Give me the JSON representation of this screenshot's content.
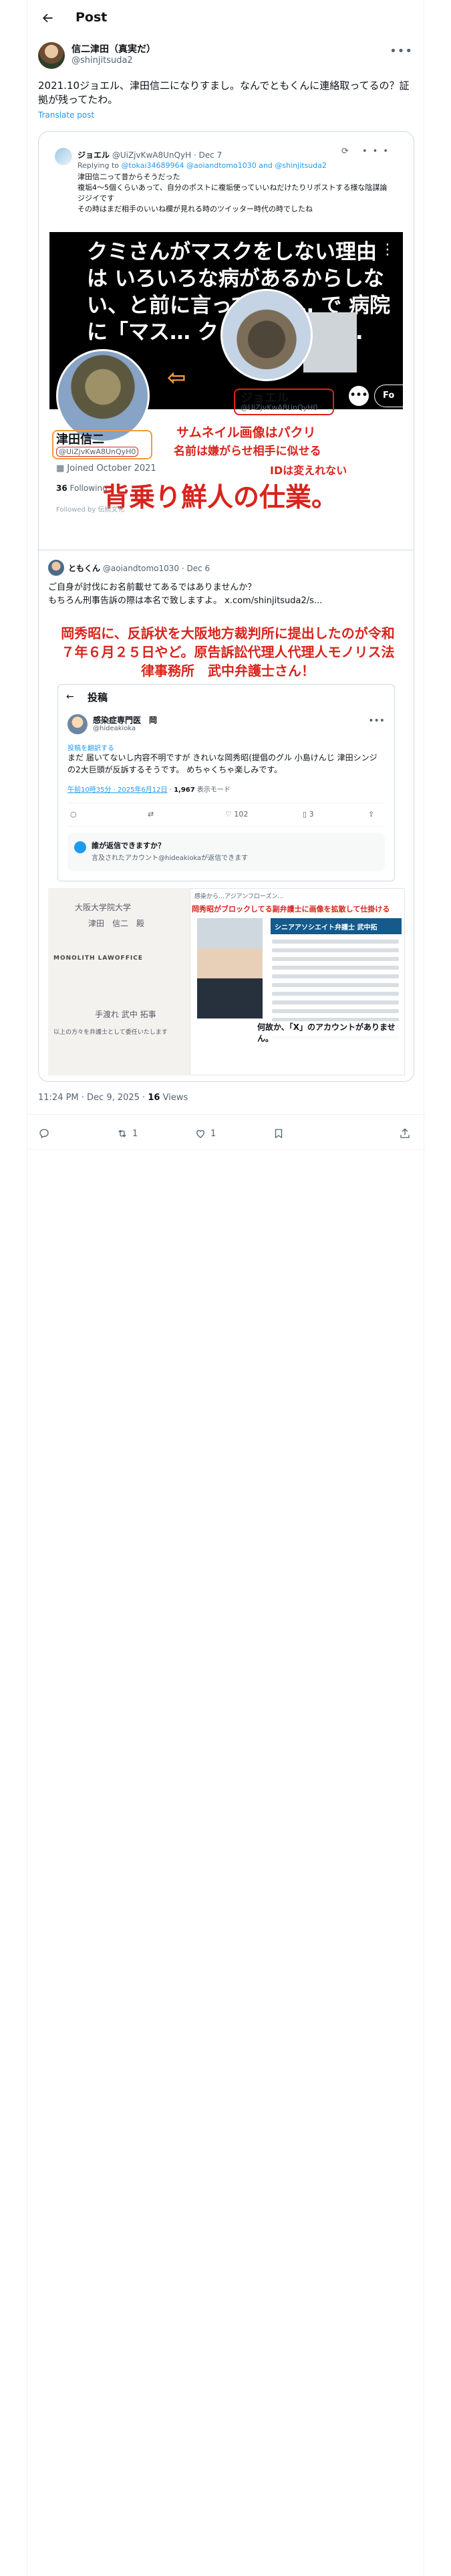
{
  "header": {
    "title": "Post"
  },
  "author": {
    "name": "信二津田（真実だ）",
    "handle": "@shinjitsuda2"
  },
  "post": {
    "text": "2021.10ジョエル、津田信二になりすまし。なんでともくんに連絡取ってるの？証拠が残ってたわ。",
    "translate_label": "Translate post"
  },
  "quote1": {
    "name": "ジョエル",
    "handle_time": "@UiZjvKwA8UnQyH · Dec 7",
    "replying_prefix": "Replying to",
    "replying_to": "@tokai34689964 @aoiandtomo1030 and @shinjitsuda2",
    "body": "津田信二って昔からそうだった\n複垢4〜5個くらいあって、自分のポストに複垢使っていいねだけたりリポストする様な陰謀論ジジイです\nその時はまだ相手のいいね欄が見れる時のツイッター時代の時でしたね",
    "image": {
      "dark_text": "クミさんがマスクをしない理由は いろいろな病があるからしない、と前に言ってた…… で 病院に「マス… クして……でた…",
      "more": "•••",
      "follow": "Fo",
      "joel_name": "ジョエル",
      "joel_handle": "@UiZjvKwA8UnQyH0",
      "tsuda_name": "津田信二",
      "tsuda_handle": "@UiZjvKwA8UnQyH0",
      "red_1": "サムネイル画像はパクリ",
      "red_2": "名前は嫌がらせ相手に似せる",
      "red_3": "IDは変えれない",
      "joined": "Joined October 2021",
      "following_count": "36",
      "following_label": "Following",
      "followed_by": "Followed by 伝統文化",
      "big_red": "背乗り鮮人の仕業。"
    }
  },
  "quote2": {
    "name": "ともくん",
    "handle_time": "@aoiandtomo1030 · Dec 6",
    "body": "ご自身が討伐にお名前載せてあるではありませんか？\nもちろん刑事告訴の際は本名で致しますよ。 x.com/shinjitsuda2/s...",
    "red_text": "岡秀昭に、反訴状を大阪地方裁判所に提出したのが令和７年６月２５日やど。原告訴訟代理人代理人モノリス法律事務所　武中弁護士さん！",
    "inner": {
      "back": "←",
      "title": "投稿",
      "name": "感染症専門医　岡",
      "handle": "@hideakioka",
      "translate": "投稿を翻訳する",
      "text": "まだ 届いてないし内容不明ですが きれいな岡秀昭(提倡のグル 小島けんじ 津田シンジの2大巨頭が反訴するそうです。 めちゃくちゃ楽しみです。",
      "time": "午前10時35分 · 2025年6月12日",
      "views": "1,967",
      "views_label": "表示モード",
      "replies": "",
      "reposts": "",
      "likes": "102",
      "bookmarks": "3",
      "notice_title": "誰が返信できますか？",
      "notice_sub": "言及されたアカウント@hideakiokaが返信できます"
    },
    "doc_left": {
      "line1": "大阪大学院大学",
      "line2": "津田　信二　殿",
      "logo": "MONOLITH LAWOFFICE",
      "line3": "手渡れ 武中 拓事",
      "line4": "以上の方々を弁護士として委任いたします"
    },
    "doc_right": {
      "top": "感染から…アジアンフローズン…",
      "red": "岡秀昭がブロックしてる副弁護士に画像を拡散して仕掛ける",
      "banner": "シニアアソシエイト弁護士 武中拓",
      "caption": "何故か、「X」のアカウントがありません。"
    }
  },
  "meta": {
    "time": "11:24 PM · Dec 9, 2025",
    "views_count": "16",
    "views_label": "Views"
  },
  "actions": {
    "retweets": "1",
    "likes": "1"
  }
}
